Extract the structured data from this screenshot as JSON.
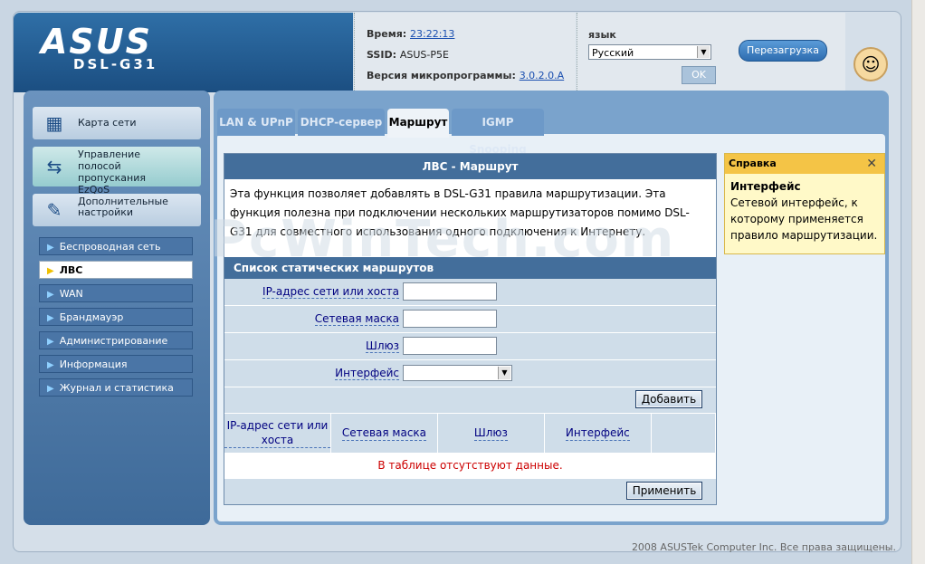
{
  "header": {
    "brand": "ASUS",
    "model": "DSL-G31",
    "time_label": "Время:",
    "time_value": "23:22:13",
    "ssid_label": "SSID:",
    "ssid_value": "ASUS-P5E",
    "firmware_label": "Версия микропрограммы:",
    "firmware_value": "3.0.2.0.A",
    "lang_label": "язык",
    "lang_value": "Русский",
    "ok_label": "OK",
    "reboot_label": "Перезагрузка"
  },
  "sidebar": {
    "main": [
      {
        "label": "Карта сети"
      },
      {
        "label": "Управление полосой пропускания EzQoS"
      },
      {
        "label": "Дополнительные настройки"
      }
    ],
    "items": [
      {
        "label": "Беспроводная сеть"
      },
      {
        "label": "ЛВС"
      },
      {
        "label": "WAN"
      },
      {
        "label": "Брандмауэр"
      },
      {
        "label": "Администрирование"
      },
      {
        "label": "Информация"
      },
      {
        "label": "Журнал и статистика"
      }
    ]
  },
  "tabs": [
    {
      "label": "LAN & UPnP"
    },
    {
      "label": "DHCP-сервер"
    },
    {
      "label": "Маршрут"
    },
    {
      "label": "IGMP Snooping"
    }
  ],
  "panel": {
    "title": "ЛВС - Маршрут",
    "description": "Эта функция позволяет добавлять в DSL-G31 правила маршрутизации. Эта функция полезна при подключении нескольких маршрутизаторов помимо DSL-G31 для совместного использования одного подключения к Интернету.",
    "section_title": "Список статических маршрутов",
    "fields": [
      {
        "label": "IP-адрес сети или хоста",
        "value": ""
      },
      {
        "label": "Сетевая маска",
        "value": ""
      },
      {
        "label": "Шлюз",
        "value": ""
      },
      {
        "label": "Интерфейс",
        "value": ""
      }
    ],
    "add_label": "Добавить",
    "columns": [
      "IP-адрес сети или хоста",
      "Сетевая маска",
      "Шлюз",
      "Интерфейс",
      ""
    ],
    "empty_message": "В таблице отсутствуют данные.",
    "apply_label": "Применить"
  },
  "help": {
    "title": "Справка",
    "close": "✕",
    "heading": "Интерфейс",
    "text": "Сетевой интерфейс, к которому применяется правило маршрутизации."
  },
  "footer": "2008 ASUSTek Computer Inc. Все права защищены.",
  "watermark": "PcWinTech.com"
}
